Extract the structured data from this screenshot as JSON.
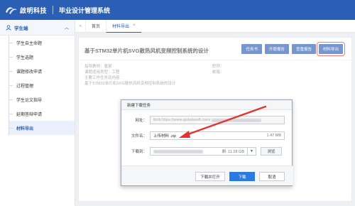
{
  "header": {
    "logo_text": "啟明科技",
    "system_title": "毕业设计管理系统"
  },
  "sidebar": {
    "group_label": "学生端",
    "items": [
      {
        "label": "学生自主命题",
        "active": false
      },
      {
        "label": "学生选题",
        "active": false
      },
      {
        "label": "课题修改申请",
        "active": false
      },
      {
        "label": "过程管理",
        "active": false
      },
      {
        "label": "学生论文指导",
        "active": false
      },
      {
        "label": "延期答辩申请",
        "active": false
      },
      {
        "label": "材料导出",
        "active": true
      }
    ]
  },
  "tabs": {
    "items": [
      {
        "label": "首页",
        "active": false
      },
      {
        "label": "材料导出",
        "active": true,
        "close": "×"
      }
    ]
  },
  "card": {
    "title": "基于STM32单片机SVG散热风机变频控制系统的设计",
    "buttons": [
      "任务书",
      "开题报告",
      "查重报告",
      "材料导出"
    ],
    "info": {
      "advisor": "指导教师：唐寅",
      "topic_type": "课题适用类型：工程",
      "contents": "主要工作任务及内容：",
      "contents_value": "基于STM32单片机SVG散热风机变频控制系统的设计",
      "title_label": "职称：",
      "email_label": "邮箱："
    }
  },
  "dialog": {
    "title": "新建下载任务",
    "url_label": "网址：",
    "url_value": "blob:https://www.qzdatasoft.com/",
    "filename_label": "文件名：",
    "filename_value": "上传材料 .zip",
    "file_size": "1.47 MB",
    "download_to_label": "下载到：",
    "free_space": "剩: 11.28 GB",
    "browse_label": "浏览",
    "btn_download_open": "下载并打开",
    "btn_download": "下载",
    "btn_cancel": "取消"
  },
  "colors": {
    "brand": "#2b5fb5",
    "highlight": "#e3342f"
  }
}
